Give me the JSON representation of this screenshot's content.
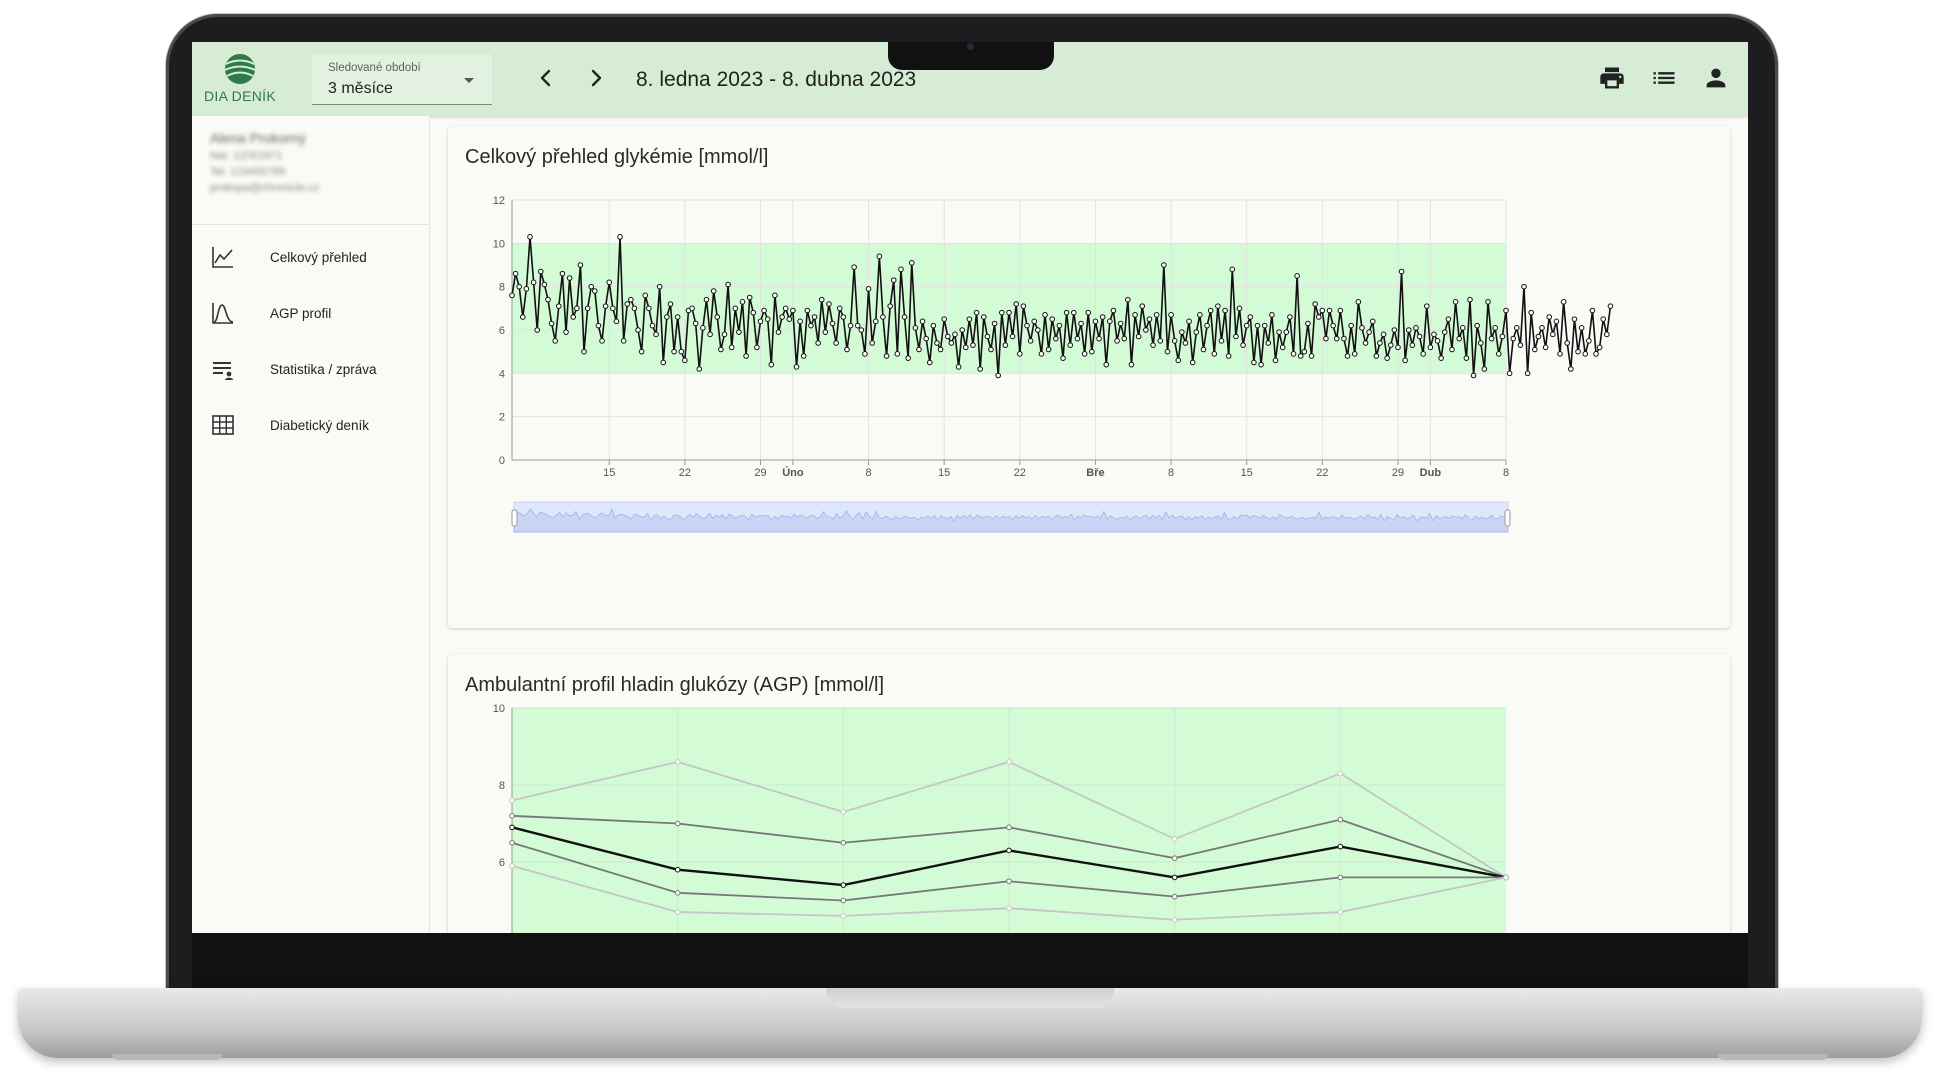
{
  "app": {
    "name": "DIA DENÍK",
    "colors": {
      "brand": "#2f7a46",
      "topbar": "#d6ecd4",
      "target_range": "#d3fcd6",
      "line": "#111111"
    }
  },
  "header": {
    "period_label": "Sledované období",
    "period_value": "3 měsíce",
    "date_range": "8. ledna 2023 - 8. dubna 2023",
    "icons": [
      "chevron-left-icon",
      "chevron-right-icon",
      "printer-icon",
      "list-icon",
      "account-icon"
    ]
  },
  "sidebar": {
    "user": {
      "name": "Alena Prokorný",
      "line1": "Nar. 12/3/1971",
      "line2": "Tel. 123456789",
      "line3": "prokopa@chronicle.cz"
    },
    "items": [
      {
        "label": "Celkový přehled",
        "icon": "line-chart-icon"
      },
      {
        "label": "AGP profil",
        "icon": "bell-curve-icon"
      },
      {
        "label": "Statistika / zpráva",
        "icon": "report-icon"
      },
      {
        "label": "Diabetický deník",
        "icon": "table-icon"
      }
    ]
  },
  "overview_card": {
    "title": "Celkový přehled glykémie [mmol/l]"
  },
  "agp_card": {
    "title": "Ambulantní profil hladin glukózy (AGP) [mmol/l]"
  },
  "chart_data": [
    {
      "type": "line",
      "title": "Celkový přehled glykémie [mmol/l]",
      "x_axis": "time",
      "xlim": [
        "2023-01-06",
        "2023-04-08"
      ],
      "ylim": [
        0,
        12
      ],
      "y_ticks": [
        0,
        2,
        4,
        6,
        8,
        10,
        12
      ],
      "x_ticks": [
        {
          "label": "15",
          "date": "2023-01-15",
          "bold": false
        },
        {
          "label": "22",
          "date": "2023-01-22",
          "bold": false
        },
        {
          "label": "29",
          "date": "2023-01-29",
          "bold": false
        },
        {
          "label": "Úno",
          "date": "2023-02-01",
          "bold": true
        },
        {
          "label": "8",
          "date": "2023-02-08",
          "bold": false
        },
        {
          "label": "15",
          "date": "2023-02-15",
          "bold": false
        },
        {
          "label": "22",
          "date": "2023-02-22",
          "bold": false
        },
        {
          "label": "Bře",
          "date": "2023-03-01",
          "bold": true
        },
        {
          "label": "8",
          "date": "2023-03-08",
          "bold": false
        },
        {
          "label": "15",
          "date": "2023-03-15",
          "bold": false
        },
        {
          "label": "22",
          "date": "2023-03-22",
          "bold": false
        },
        {
          "label": "29",
          "date": "2023-03-29",
          "bold": false
        },
        {
          "label": "Dub",
          "date": "2023-04-01",
          "bold": true
        },
        {
          "label": "8",
          "date": "2023-04-08",
          "bold": false
        }
      ],
      "target_range": [
        4,
        10
      ],
      "grid": true,
      "navigator": true,
      "series": [
        {
          "start": "2023-01-06",
          "step_hours": 8,
          "values": [
            7.6,
            8.6,
            8.0,
            6.6,
            7.9,
            10.3,
            8.2,
            6.0,
            8.7,
            8.1,
            7.4,
            6.3,
            5.5,
            7.1,
            8.6,
            5.9,
            8.4,
            6.6,
            7.0,
            9.0,
            5.0,
            7.0,
            8.0,
            7.8,
            6.2,
            5.5,
            7.1,
            8.2,
            7.0,
            6.4,
            10.3,
            5.5,
            7.2,
            7.4,
            7.0,
            6.0,
            5.0,
            7.6,
            7.0,
            6.2,
            5.8,
            8.0,
            4.5,
            6.6,
            7.2,
            5.0,
            6.6,
            5.0,
            4.6,
            6.9,
            7.0,
            6.3,
            4.2,
            6.1,
            7.4,
            5.8,
            7.8,
            6.6,
            5.1,
            5.8,
            8.1,
            5.2,
            7.0,
            5.9,
            7.3,
            4.8,
            7.5,
            6.8,
            5.2,
            6.4,
            6.9,
            6.5,
            4.4,
            7.6,
            5.9,
            6.6,
            7.0,
            6.5,
            6.9,
            4.3,
            6.4,
            4.8,
            6.9,
            6.2,
            6.6,
            5.4,
            7.4,
            5.9,
            7.2,
            6.3,
            5.4,
            7.0,
            6.6,
            5.1,
            6.2,
            8.9,
            6.2,
            6.0,
            4.9,
            7.9,
            5.4,
            6.4,
            9.4,
            6.6,
            4.8,
            7.1,
            8.3,
            4.9,
            8.8,
            6.6,
            4.7,
            9.1,
            6.1,
            5.1,
            6.4,
            5.6,
            4.5,
            6.2,
            5.4,
            5.1,
            6.5,
            5.7,
            5.4,
            5.8,
            4.3,
            6.0,
            5.2,
            6.5,
            5.3,
            6.8,
            4.2,
            6.6,
            5.7,
            5.1,
            6.3,
            3.9,
            6.8,
            5.3,
            6.8,
            5.7,
            7.2,
            4.9,
            7.1,
            6.2,
            5.5,
            6.4,
            6.0,
            4.9,
            6.7,
            5.1,
            6.5,
            5.6,
            6.2,
            4.7,
            6.8,
            5.3,
            6.8,
            5.6,
            6.3,
            4.9,
            6.8,
            5.0,
            6.4,
            5.6,
            6.6,
            4.4,
            6.4,
            6.9,
            5.5,
            6.3,
            5.6,
            7.4,
            4.4,
            6.7,
            5.7,
            7.1,
            6.0,
            6.5,
            5.3,
            6.7,
            5.5,
            9.0,
            5.0,
            6.7,
            5.5,
            4.6,
            5.9,
            5.4,
            6.4,
            4.5,
            5.9,
            6.7,
            5.1,
            6.2,
            6.9,
            4.9,
            7.1,
            5.5,
            6.9,
            4.8,
            8.8,
            5.7,
            7.0,
            5.3,
            6.2,
            6.6,
            4.5,
            6.2,
            4.4,
            6.2,
            5.4,
            6.7,
            4.6,
            5.9,
            5.2,
            5.9,
            6.6,
            4.9,
            8.5,
            4.8,
            5.0,
            6.3,
            4.8,
            7.2,
            6.6,
            6.9,
            5.6,
            6.9,
            6.2,
            5.6,
            6.9,
            5.6,
            4.8,
            6.2,
            4.9,
            7.3,
            6.1,
            5.4,
            5.9,
            6.4,
            4.8,
            5.4,
            5.8,
            4.7,
            5.3,
            6.0,
            5.2,
            8.7,
            4.6,
            6.0,
            5.3,
            6.1,
            5.7,
            4.9,
            7.1,
            5.2,
            5.8,
            5.5,
            4.7,
            5.9,
            6.5,
            5.1,
            7.3,
            5.6,
            6.1,
            4.7,
            7.4,
            3.9,
            6.2,
            5.4,
            4.2,
            7.3,
            5.6,
            6.1,
            4.9,
            5.7,
            6.9,
            4.0,
            5.6,
            6.1,
            5.3,
            8.0,
            4.0,
            6.8,
            5.1,
            5.7,
            6.1,
            5.2,
            6.6,
            5.8,
            6.4,
            4.9,
            7.3,
            5.4,
            4.2,
            6.5,
            5.0,
            6.1,
            4.9,
            5.5,
            6.9,
            4.9,
            5.2,
            6.5,
            5.8,
            7.1
          ]
        }
      ]
    },
    {
      "type": "line",
      "title": "Ambulantní profil hladin glukózy (AGP) [mmol/l]",
      "ylim_visible": [
        4.5,
        10
      ],
      "y_ticks": [
        6,
        8,
        10
      ],
      "grid": true,
      "series": [
        {
          "role": "outer-upper",
          "values": [
            7.6,
            8.6,
            7.3,
            8.6,
            6.6,
            8.3,
            5.6
          ]
        },
        {
          "role": "inner-upper",
          "values": [
            7.2,
            7.0,
            6.5,
            6.9,
            6.1,
            7.1,
            5.6
          ]
        },
        {
          "role": "median",
          "values": [
            6.9,
            5.8,
            5.4,
            6.3,
            5.6,
            6.4,
            5.6
          ]
        },
        {
          "role": "inner-lower",
          "values": [
            6.5,
            5.2,
            5.0,
            5.5,
            5.1,
            5.6,
            5.6
          ]
        },
        {
          "role": "outer-lower",
          "values": [
            5.9,
            4.7,
            4.6,
            4.8,
            4.5,
            4.7,
            5.6
          ]
        }
      ]
    }
  ]
}
